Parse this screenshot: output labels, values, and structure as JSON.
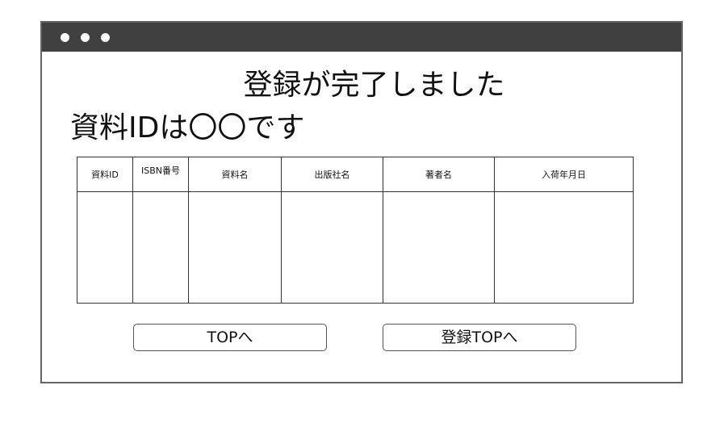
{
  "window": {
    "title_dots": [
      "",
      "",
      ""
    ]
  },
  "page": {
    "title": "登録が完了しました",
    "id_message": "資料IDは〇〇です"
  },
  "table": {
    "columns": [
      "資料ID",
      "ISBN番号",
      "資料名",
      "出版社名",
      "著者名",
      "入荷年月日"
    ],
    "rows": []
  },
  "buttons": {
    "top_label": "TOPへ",
    "register_top_label": "登録TOPへ"
  }
}
